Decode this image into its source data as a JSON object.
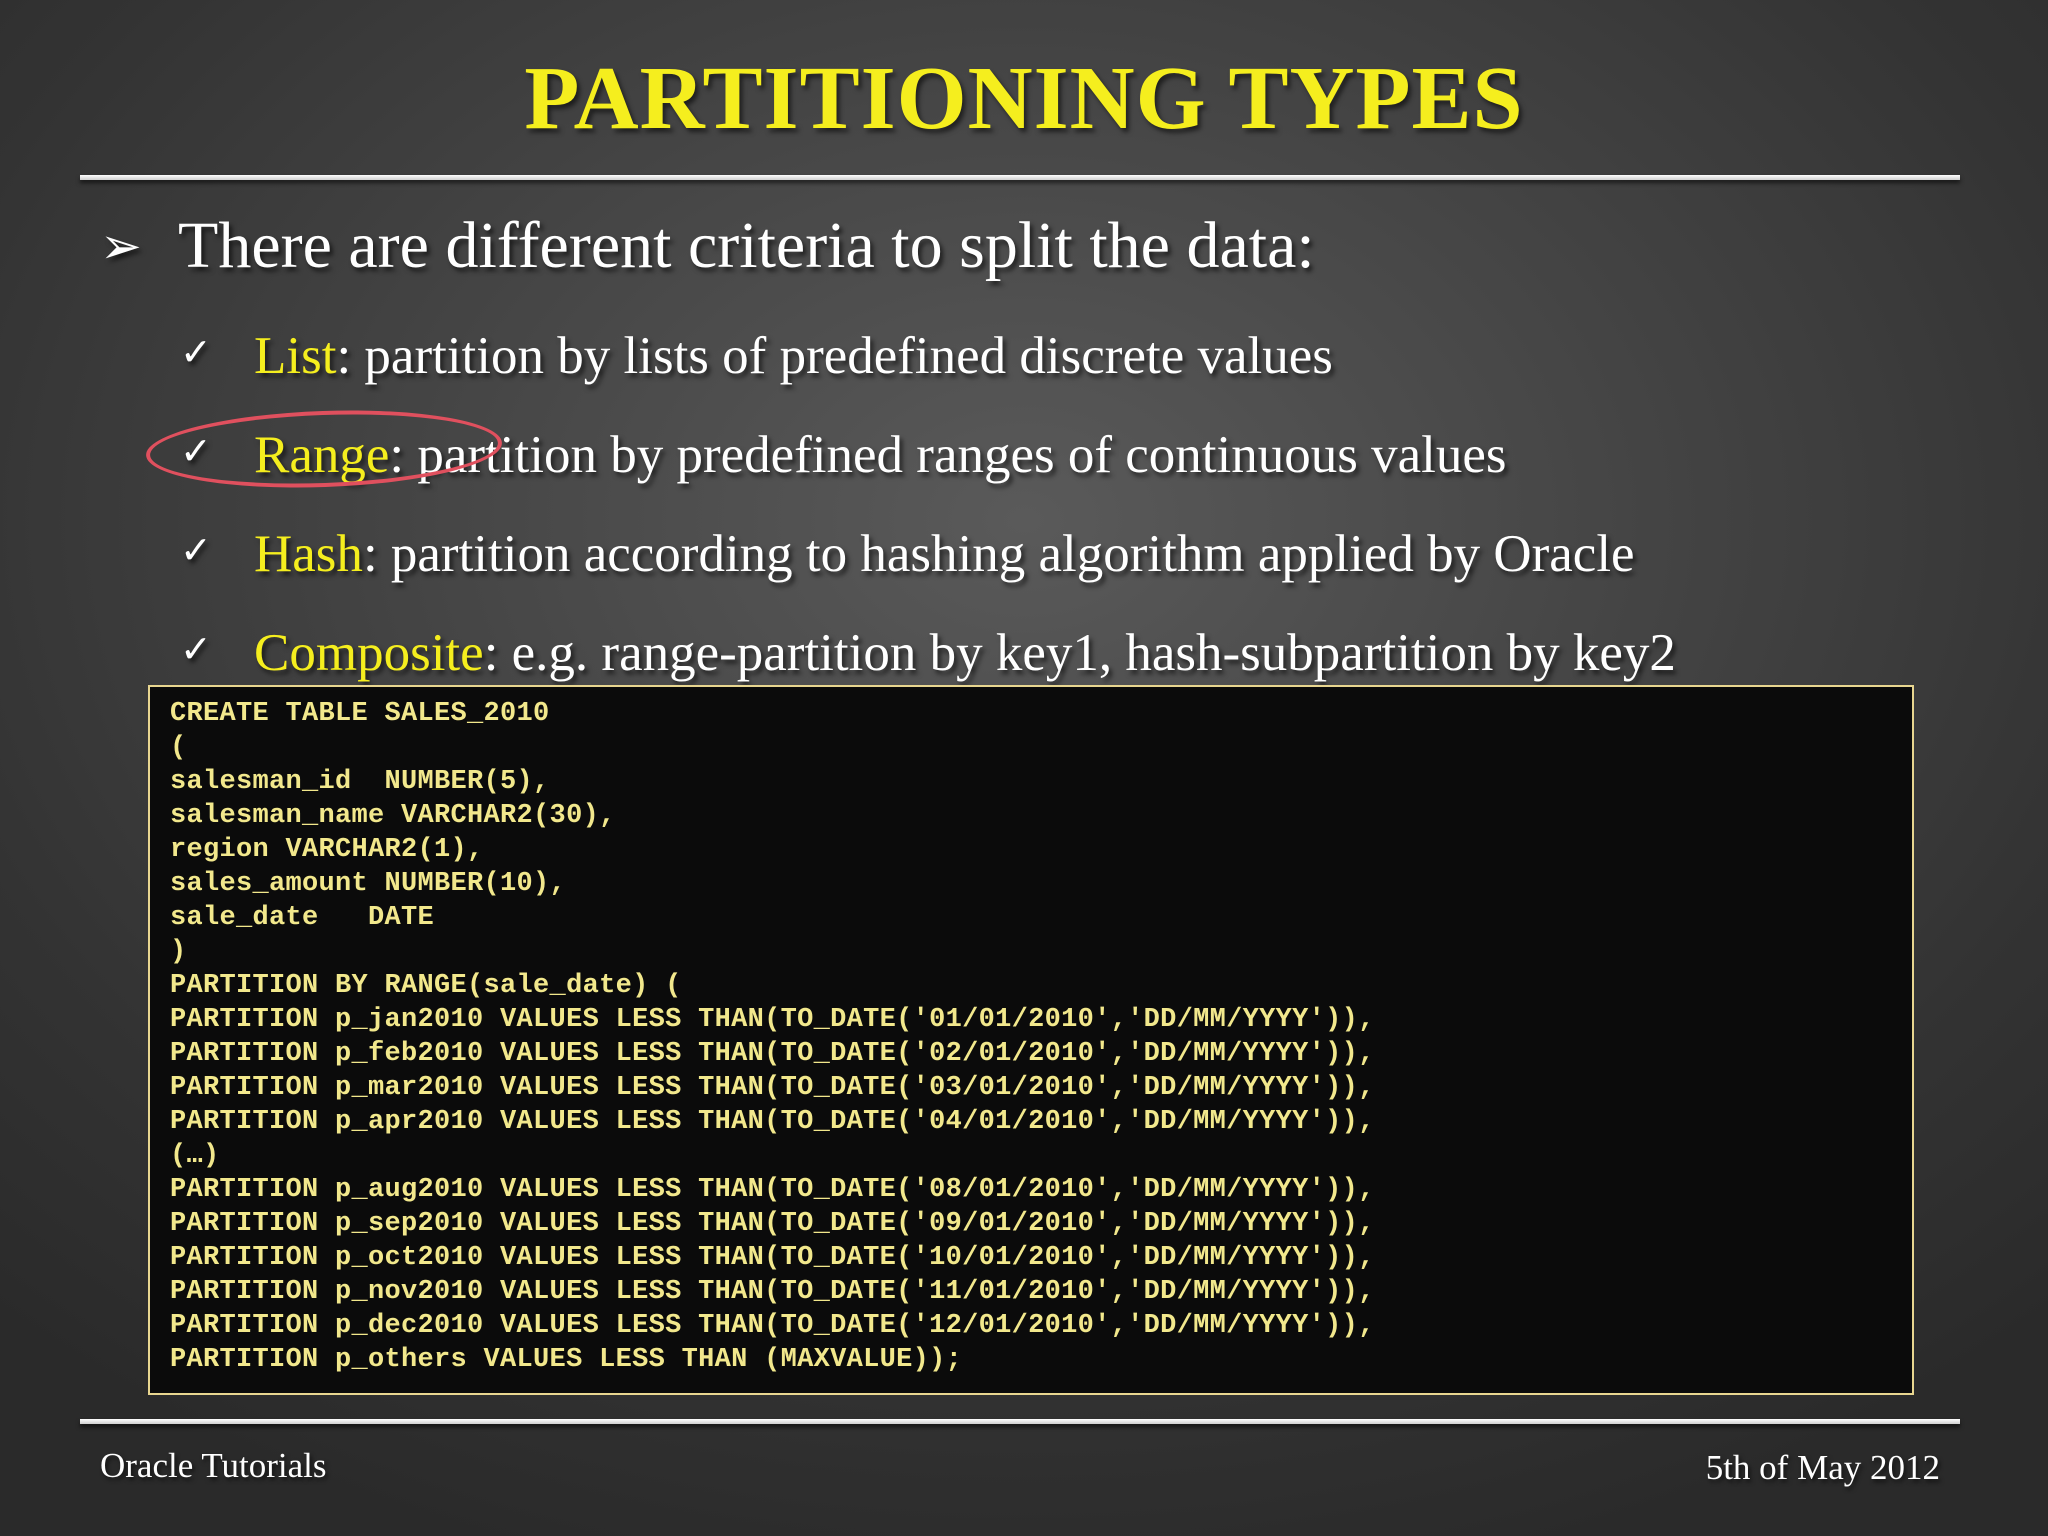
{
  "slide": {
    "title": "PARTITIONING TYPES",
    "intro": "There are different criteria to split the data:",
    "criteria": [
      {
        "term": "List",
        "desc": ": partition by lists of predefined discrete values"
      },
      {
        "term": "Range",
        "desc": ": partition by predefined ranges of continuous values"
      },
      {
        "term": "Hash",
        "desc": ": partition according to hashing algorithm applied by Oracle"
      },
      {
        "term": "Composite",
        "desc": ": e.g. range-partition by key1, hash-subpartition by key2"
      }
    ],
    "highlighted_criterion": "Range",
    "code": [
      "CREATE TABLE SALES_2010",
      "(",
      "salesman_id  NUMBER(5),",
      "salesman_name VARCHAR2(30),",
      "region VARCHAR2(1),",
      "sales_amount NUMBER(10),",
      "sale_date   DATE",
      ")",
      "PARTITION BY RANGE(sale_date) (",
      "PARTITION p_jan2010 VALUES LESS THAN(TO_DATE('01/01/2010','DD/MM/YYYY')),",
      "PARTITION p_feb2010 VALUES LESS THAN(TO_DATE('02/01/2010','DD/MM/YYYY')),",
      "PARTITION p_mar2010 VALUES LESS THAN(TO_DATE('03/01/2010','DD/MM/YYYY')),",
      "PARTITION p_apr2010 VALUES LESS THAN(TO_DATE('04/01/2010','DD/MM/YYYY')),",
      "(…)",
      "PARTITION p_aug2010 VALUES LESS THAN(TO_DATE('08/01/2010','DD/MM/YYYY')),",
      "PARTITION p_sep2010 VALUES LESS THAN(TO_DATE('09/01/2010','DD/MM/YYYY')),",
      "PARTITION p_oct2010 VALUES LESS THAN(TO_DATE('10/01/2010','DD/MM/YYYY')),",
      "PARTITION p_nov2010 VALUES LESS THAN(TO_DATE('11/01/2010','DD/MM/YYYY')),",
      "PARTITION p_dec2010 VALUES LESS THAN(TO_DATE('12/01/2010','DD/MM/YYYY')),",
      "PARTITION p_others VALUES LESS THAN (MAXVALUE));"
    ]
  },
  "footer": {
    "left": "Oracle Tutorials",
    "right": "5th of May 2012"
  },
  "icons": {
    "bullet": "arrowhead-bullet-icon",
    "criterion": "checkmark-icon"
  },
  "colors": {
    "title": "#f5ee1e",
    "term": "#f5ee1e",
    "code_text": "#f2e88c",
    "code_background": "#0b0b0b",
    "highlight": "#e0505e"
  }
}
